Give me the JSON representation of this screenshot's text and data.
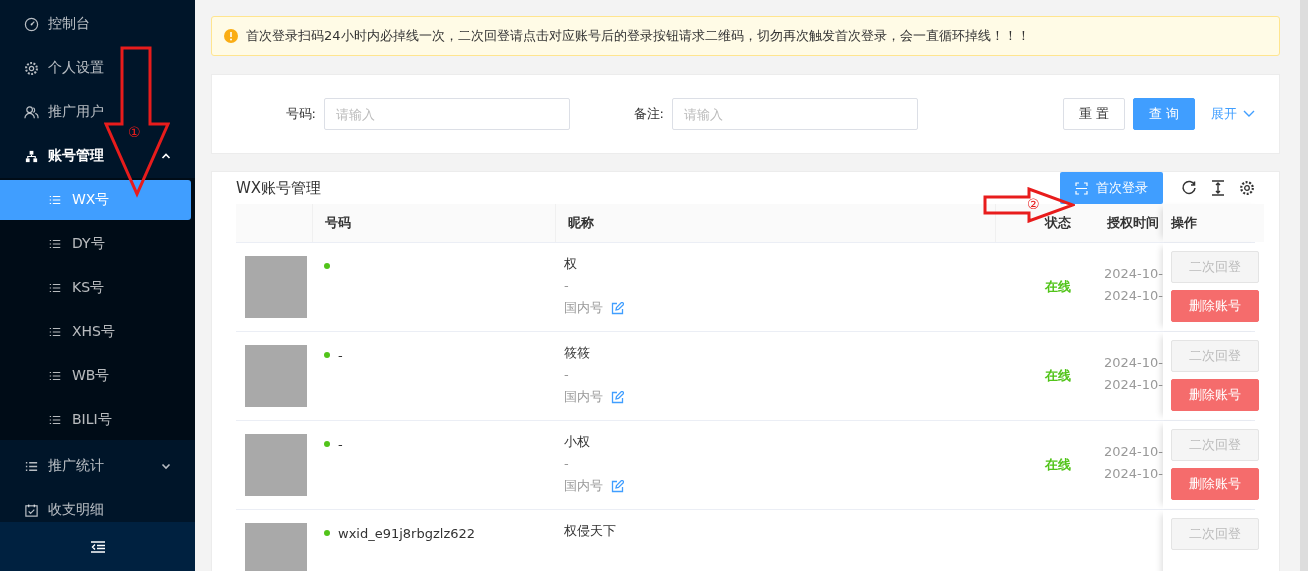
{
  "sidebar": {
    "items": [
      {
        "label": "控制台"
      },
      {
        "label": "个人设置"
      },
      {
        "label": "推广用户"
      },
      {
        "label": "账号管理",
        "expanded": true,
        "children": [
          {
            "label": "WX号",
            "selected": true
          },
          {
            "label": "DY号",
            "selected": false
          },
          {
            "label": "KS号",
            "selected": false
          },
          {
            "label": "XHS号",
            "selected": false
          },
          {
            "label": "WB号",
            "selected": false
          },
          {
            "label": "BILI号",
            "selected": false
          }
        ]
      },
      {
        "label": "推广统计",
        "expanded": false
      },
      {
        "label": "收支明细"
      }
    ]
  },
  "alert": {
    "text": "首次登录扫码24小时内必掉线一次，二次回登请点击对应账号后的登录按钮请求二维码，切勿再次触发首次登录，会一直循环掉线！！！"
  },
  "search": {
    "fields": [
      {
        "label": "号码:",
        "placeholder": "请输入"
      },
      {
        "label": "备注:",
        "placeholder": "请输入"
      }
    ],
    "reset": "重 置",
    "query": "查 询",
    "expand": "展开"
  },
  "table_card": {
    "title": "WX账号管理",
    "primary_button": "首次登录",
    "columns": [
      "号码",
      "昵称",
      "",
      "状态",
      "授权时间",
      "操作"
    ],
    "rows": [
      {
        "online": true,
        "id_lines": [],
        "nickname": "权",
        "note": "-",
        "region": "国内号",
        "status": "在线",
        "times": [
          "2024-10-",
          "2024-10-"
        ],
        "actions": [
          {
            "label": "二次回登",
            "kind": "relogin",
            "disabled": true
          },
          {
            "label": "删除账号",
            "kind": "delete",
            "disabled": false
          }
        ]
      },
      {
        "online": true,
        "id_lines": [
          "-"
        ],
        "nickname": "筱筱",
        "note": "-",
        "region": "国内号",
        "status": "在线",
        "times": [
          "2024-10-",
          "2024-10-"
        ],
        "actions": [
          {
            "label": "二次回登",
            "kind": "relogin",
            "disabled": true
          },
          {
            "label": "删除账号",
            "kind": "delete",
            "disabled": false
          }
        ]
      },
      {
        "online": true,
        "id_lines": [
          "-"
        ],
        "nickname": "小权",
        "note": "-",
        "region": "国内号",
        "status": "在线",
        "times": [
          "2024-10-",
          "2024-10-"
        ],
        "actions": [
          {
            "label": "二次回登",
            "kind": "relogin",
            "disabled": true
          },
          {
            "label": "删除账号",
            "kind": "delete",
            "disabled": false
          }
        ]
      },
      {
        "online": true,
        "id_lines": [
          "wxid_e91j8rbgzlz622"
        ],
        "nickname": "权侵天下",
        "actions": [
          {
            "label": "二次回登",
            "kind": "relogin",
            "disabled": true
          }
        ]
      }
    ]
  },
  "annotations": [
    {
      "label": "①",
      "kind": "down"
    },
    {
      "label": "②",
      "kind": "right"
    }
  ]
}
